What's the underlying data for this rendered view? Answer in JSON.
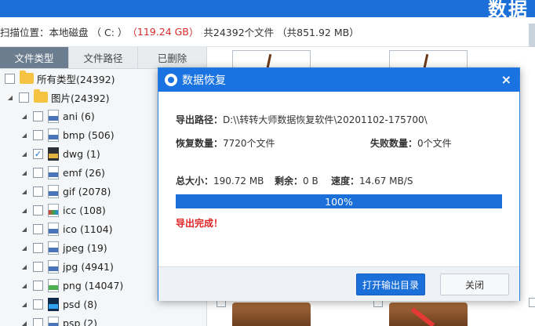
{
  "app": {
    "brand": "数据"
  },
  "scan": {
    "label": "扫描位置：",
    "disk": "本地磁盘 （ C: ）",
    "size_open": "（",
    "size": "119.24 GB",
    "size_close": "）",
    "total": "共24392个文件 （共851.92 MB）"
  },
  "tabs": [
    {
      "label": "文件类型"
    },
    {
      "label": "文件路径"
    },
    {
      "label": "已删除"
    }
  ],
  "tree": {
    "root": {
      "label": "所有类型(24392)"
    },
    "images": {
      "label": "图片(24392)"
    },
    "items": [
      {
        "label": "ani (6)",
        "checked": false
      },
      {
        "label": "bmp (506)",
        "checked": false
      },
      {
        "label": "dwg (1)",
        "checked": true
      },
      {
        "label": "emf (26)",
        "checked": false
      },
      {
        "label": "gif (2078)",
        "checked": false
      },
      {
        "label": "icc (108)",
        "checked": false
      },
      {
        "label": "ico (1104)",
        "checked": false
      },
      {
        "label": "jpeg (19)",
        "checked": false
      },
      {
        "label": "jpg (4941)",
        "checked": false
      },
      {
        "label": "png (14047)",
        "checked": false
      },
      {
        "label": "psd (8)",
        "checked": false
      },
      {
        "label": "psp (2)",
        "checked": false
      }
    ]
  },
  "dialog": {
    "title": "数据恢复",
    "close_glyph": "×",
    "export_label": "导出路径：",
    "export_path": "D:\\\\转转大师数据恢复软件\\20201102-175700\\",
    "recovered_label": "恢复数量：",
    "recovered_value": "7720个文件",
    "failed_label": "失败数量：",
    "failed_value": "0个文件",
    "total_label": "总大小：",
    "total_value": "190.72 MB",
    "remaining_label": "剩余：",
    "remaining_value": "0 B",
    "speed_label": "速度：",
    "speed_value": "14.67 MB/S",
    "progress_text": "100%",
    "progress_value": 1.0,
    "done_text": "导出完成！",
    "open_button": "打开输出目录",
    "close_button": "关闭"
  }
}
